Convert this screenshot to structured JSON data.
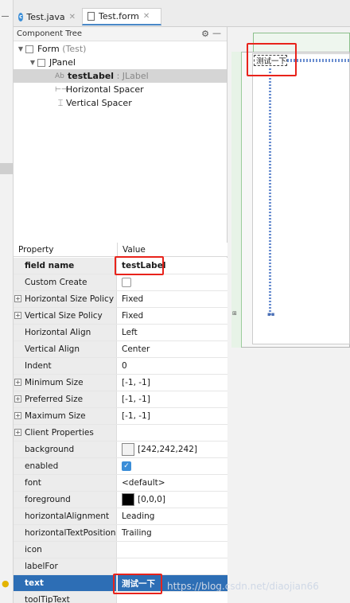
{
  "tabs": [
    {
      "label": "Test.java",
      "icon": "class-icon"
    },
    {
      "label": "Test.form",
      "icon": "form-file-icon"
    }
  ],
  "component_tree": {
    "title": "Component Tree",
    "items": [
      {
        "label": "Form",
        "suffix": "(Test)"
      },
      {
        "label": "JPanel"
      },
      {
        "label": "testLabel",
        "suffix": ": JLabel",
        "prefix": "Ab"
      },
      {
        "label": "Horizontal Spacer"
      },
      {
        "label": "Vertical Spacer"
      }
    ]
  },
  "properties": {
    "header_property": "Property",
    "header_value": "Value",
    "rows": [
      {
        "name": "field name",
        "value": "testLabel"
      },
      {
        "name": "Custom Create",
        "value": ""
      },
      {
        "name": "Horizontal Size Policy",
        "value": "Fixed"
      },
      {
        "name": "Vertical Size Policy",
        "value": "Fixed"
      },
      {
        "name": "Horizontal Align",
        "value": "Left"
      },
      {
        "name": "Vertical Align",
        "value": "Center"
      },
      {
        "name": "Indent",
        "value": "0"
      },
      {
        "name": "Minimum Size",
        "value": "[-1, -1]"
      },
      {
        "name": "Preferred Size",
        "value": "[-1, -1]"
      },
      {
        "name": "Maximum Size",
        "value": "[-1, -1]"
      },
      {
        "name": "Client Properties",
        "value": ""
      },
      {
        "name": "background",
        "value": "[242,242,242]"
      },
      {
        "name": "enabled",
        "value": ""
      },
      {
        "name": "font",
        "value": "<default>"
      },
      {
        "name": "foreground",
        "value": "[0,0,0]"
      },
      {
        "name": "horizontalAlignment",
        "value": "Leading"
      },
      {
        "name": "horizontalTextPosition",
        "value": "Trailing"
      },
      {
        "name": "icon",
        "value": ""
      },
      {
        "name": "labelFor",
        "value": ""
      },
      {
        "name": "text",
        "value": "测试一下"
      },
      {
        "name": "toolTipText",
        "value": ""
      }
    ]
  },
  "canvas": {
    "label_text": "测试一下"
  },
  "colors": {
    "background_swatch": "#f2f2f2",
    "foreground_swatch": "#000000",
    "selection": "#2d6eb5",
    "highlight_box": "#e8231b"
  },
  "watermark": "https://blog.csdn.net/diaojian66"
}
